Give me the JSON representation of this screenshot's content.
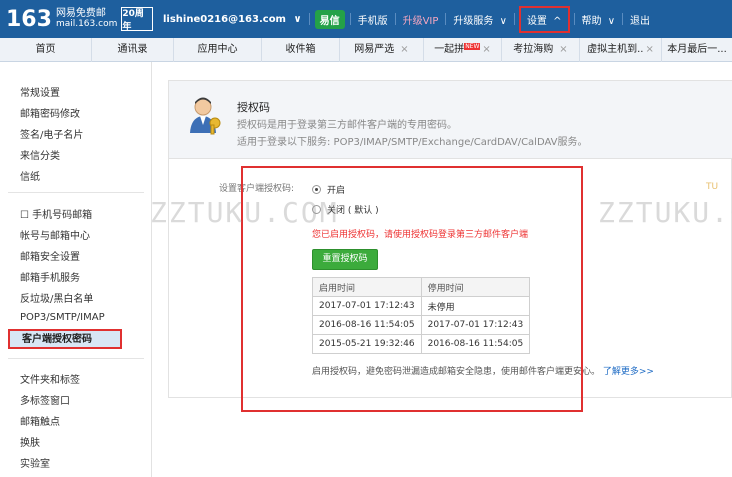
{
  "topbar": {
    "logo_number": "163",
    "logo_line1": "网易免费邮",
    "logo_line2": "mail.163.com",
    "logo_badge": "20周年",
    "user": "lishine0216@163.com",
    "user_chevron": "∨",
    "yixin": "易信",
    "mobile": "手机版",
    "vip": "升级VIP",
    "upgrade": "升级服务",
    "settings": "设置",
    "settings_chevron": "^",
    "help": "帮助",
    "help_chevron": "∨",
    "logout": "退出",
    "colors": {
      "bg": "#1e5f9e",
      "yixin": "#24a148",
      "highlight": "#e03030"
    }
  },
  "tabs": [
    {
      "label": "首页"
    },
    {
      "label": "通讯录"
    },
    {
      "label": "应用中心"
    },
    {
      "label": "收件箱"
    },
    {
      "label": "网易严选",
      "close": "×"
    },
    {
      "label": "一起拼",
      "badge": "NEW",
      "close": "×"
    },
    {
      "label": "考拉海购",
      "close": "×"
    },
    {
      "label": "虚拟主机到..",
      "close": "×"
    },
    {
      "label": "本月最后一..."
    }
  ],
  "sidebar": {
    "group1": [
      "常规设置",
      "邮箱密码修改",
      "签名/电子名片",
      "来信分类",
      "信纸"
    ],
    "group2": [
      "☐ 手机号码邮箱",
      "帐号与邮箱中心",
      "邮箱安全设置",
      "邮箱手机服务",
      "反垃圾/黑白名单",
      "POP3/SMTP/IMAP",
      "客户端授权密码"
    ],
    "group3": [
      "文件夹和标签",
      "多标签窗口",
      "邮箱触点",
      "换肤",
      "实验室"
    ]
  },
  "header": {
    "title": "授权码",
    "desc1": "授权码是用于登录第三方邮件客户端的专用密码。",
    "desc2": "适用于登录以下服务: POP3/IMAP/SMTP/Exchange/CardDAV/CalDAV服务。"
  },
  "setting": {
    "label": "设置客户端授权码:",
    "option_on": "开启",
    "option_off": "关闭 ( 默认 )",
    "selected": "开启",
    "warning": "您已启用授权码，请使用授权码登录第三方邮件客户端",
    "reset_button": "重置授权码"
  },
  "log_table": {
    "headers": [
      "启用时间",
      "停用时间"
    ],
    "rows": [
      [
        "2017-07-01 17:12:43",
        "未停用"
      ],
      [
        "2016-08-16 11:54:05",
        "2017-07-01 17:12:43"
      ],
      [
        "2015-05-21 19:32:46",
        "2016-08-16 11:54:05"
      ]
    ]
  },
  "footer": {
    "note": "启用授权码，避免密码泄漏造成邮箱安全隐患，使用邮件客户端更安心。",
    "link": "了解更多>>"
  },
  "watermark": "ZZTUKU.COM",
  "watermark_badge": "TU"
}
